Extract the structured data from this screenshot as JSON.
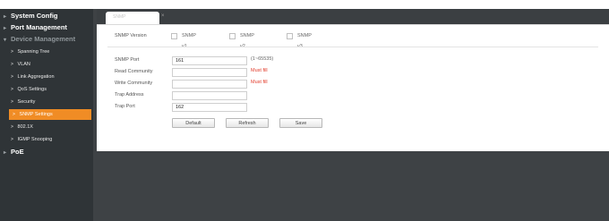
{
  "sidebar": {
    "items": [
      {
        "label": "System Config",
        "level": "top"
      },
      {
        "label": "Port Management",
        "level": "top"
      },
      {
        "label": "Device Management",
        "level": "top"
      },
      {
        "label": "Spanning Tree",
        "level": "sub"
      },
      {
        "label": "VLAN",
        "level": "sub"
      },
      {
        "label": "Link Aggregation",
        "level": "sub"
      },
      {
        "label": "QoS Settings",
        "level": "sub"
      },
      {
        "label": "Security",
        "level": "sub"
      },
      {
        "label": "SNMP Settings",
        "level": "sub",
        "active": true
      },
      {
        "label": "802.1X",
        "level": "sub"
      },
      {
        "label": "IGMP Snooping",
        "level": "sub"
      },
      {
        "label": "PoE",
        "level": "top"
      }
    ]
  },
  "tab": {
    "label": "SNMP"
  },
  "form": {
    "version_label": "SNMP Version",
    "versions": [
      {
        "label": "SNMP v1",
        "checked": false
      },
      {
        "label": "SNMP v2",
        "checked": false
      },
      {
        "label": "SNMP v3",
        "checked": false
      }
    ],
    "port_label": "SNMP Port",
    "port_value": "161",
    "port_hint": "(1~65535)",
    "read_label": "Read Community",
    "read_value": "",
    "read_hint": "Must fill",
    "write_label": "Write Community",
    "write_value": "",
    "write_hint": "Must fill",
    "trap_addr_label": "Trap Address",
    "trap_addr_value": "",
    "trap_port_label": "Trap Port",
    "trap_port_value": "162"
  },
  "buttons": {
    "default": "Default",
    "refresh": "Refresh",
    "save": "Save"
  },
  "colors": {
    "sidebar_bg": "#2f3437",
    "active_item": "#f08c25",
    "must_fill": "#e23b2a"
  }
}
